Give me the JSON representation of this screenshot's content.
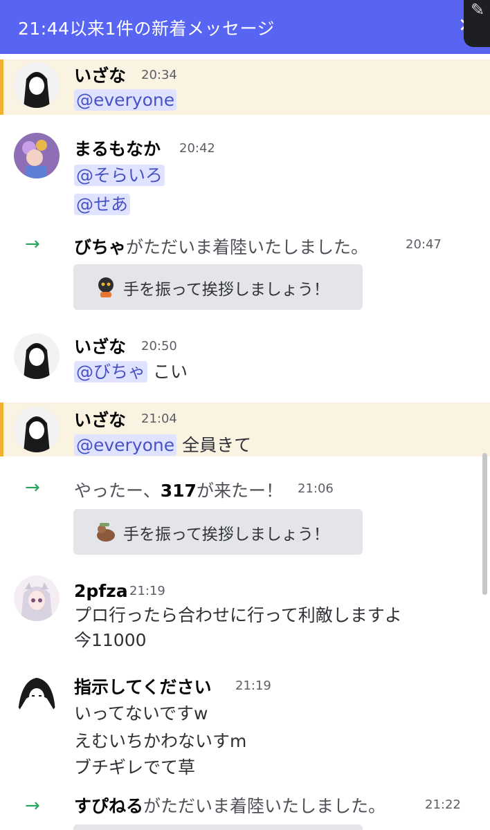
{
  "banner": {
    "text": "21:44以来1件の新着メッセージ",
    "close": "✕",
    "corner": "✎"
  },
  "messages": {
    "m1": {
      "author": "いざな",
      "time": "20:34",
      "mention": "@everyone"
    },
    "m2": {
      "author": "まるもなか",
      "time": "20:42",
      "mention1": "@そらいろ",
      "mention2": "@せあ"
    },
    "s1": {
      "user": "びちゃ",
      "text": "がただいま着陸いたしました。",
      "time": "20:47",
      "wave": "手を振って挨拶しましょう！"
    },
    "m3": {
      "author": "いざな",
      "time": "20:50",
      "mention": "@びちゃ",
      "text": " こい"
    },
    "m4": {
      "author": "いざな",
      "time": "21:04",
      "mention": "@everyone",
      "text": " 全員きて"
    },
    "s2": {
      "pre": "やったー、",
      "user": "317",
      "text": "が来たー！",
      "time": "21:06",
      "wave": "手を振って挨拶しましょう！"
    },
    "m5": {
      "author": "2pfza",
      "time": "21:19",
      "line1": "プロ行ったら合わせに行って利敵しますよ",
      "line2": "今11000"
    },
    "m6": {
      "author": "指示してください",
      "time": "21:19",
      "line1": "いってないですw",
      "line2": "えむいちかわないすm",
      "line3": "ブチギレでて草"
    },
    "s3": {
      "user": "すぴねる",
      "text": "がただいま着陸いたしました。",
      "time": "21:22"
    }
  },
  "colors": {
    "accent": "#5865f2",
    "highlight": "#faf3e2",
    "highlight_bar": "#f0b232",
    "join_arrow": "#23a55a",
    "mention_bg": "#e0e3ff",
    "mention_fg": "#4752c4"
  },
  "icons": {
    "join": "arrow-right-icon",
    "close": "close-icon"
  }
}
